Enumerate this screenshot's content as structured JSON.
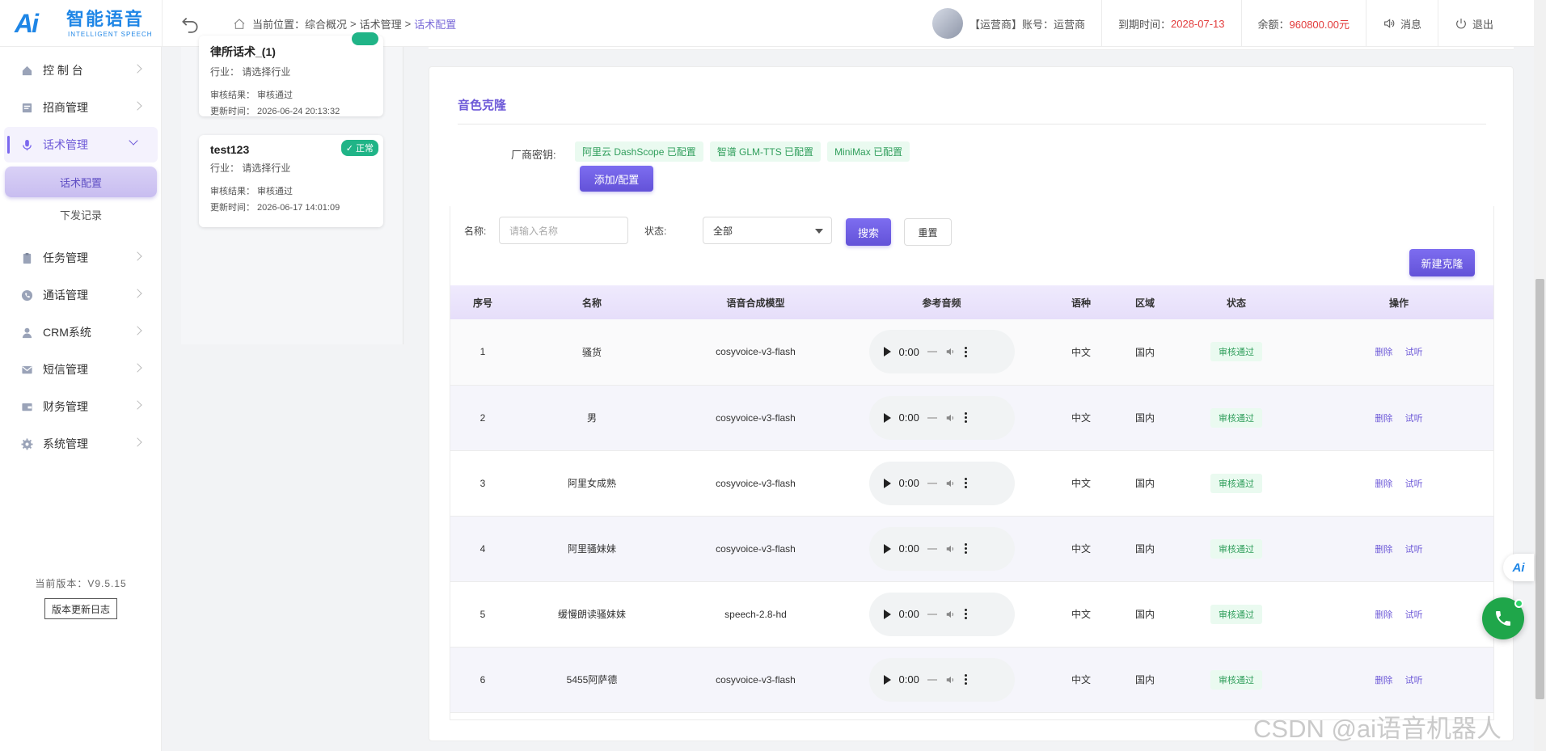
{
  "header": {
    "logo_ai": "Ai",
    "logo_cn": "智能语音",
    "logo_en": "INTELLIGENT SPEECH",
    "breadcrumb_prefix": "当前位置：",
    "breadcrumb": [
      "综合概况",
      "话术管理",
      "话术配置"
    ],
    "breadcrumb_sep": ">",
    "account": "【运营商】账号：运营商",
    "expire_label": "到期时间：",
    "expire_value": "2028-07-13",
    "balance_label": "余额：",
    "balance_value": "960800.00元",
    "message": "消息",
    "logout": "退出"
  },
  "sidebar": {
    "items": [
      {
        "label": "控 制 台",
        "icon": "home-icon"
      },
      {
        "label": "招商管理",
        "icon": "briefcase-icon"
      },
      {
        "label": "话术管理",
        "icon": "mic-icon"
      },
      {
        "label": "任务管理",
        "icon": "clipboard-icon"
      },
      {
        "label": "通话管理",
        "icon": "phone-circle-icon"
      },
      {
        "label": "CRM系统",
        "icon": "user-icon"
      },
      {
        "label": "短信管理",
        "icon": "mail-icon"
      },
      {
        "label": "财务管理",
        "icon": "wallet-icon"
      },
      {
        "label": "系统管理",
        "icon": "gear-icon"
      }
    ],
    "sub_items": [
      "话术配置",
      "下发记录"
    ],
    "version": "当前版本：V9.5.15",
    "version_log": "版本更新日志"
  },
  "cards": [
    {
      "title": "律所话术_(1)",
      "industry": "行业：   请选择行业",
      "audit": "审核结果：  审核通过",
      "updated": "更新时间：  2026-06-24 20:13:32"
    },
    {
      "title": "test123",
      "industry": "行业：   请选择行业",
      "audit": "审核结果：  审核通过",
      "updated": "更新时间：  2026-06-17 14:01:09",
      "badge": "✓ 正常"
    }
  ],
  "clone": {
    "title": "音色克隆",
    "vendor_label": "厂商密钥:",
    "vendor_tags": [
      "阿里云 DashScope 已配置",
      "智谱 GLM-TTS 已配置",
      "MiniMax 已配置"
    ],
    "add_button": "添加/配置"
  },
  "search": {
    "name_label": "名称:",
    "name_placeholder": "请输入名称",
    "status_label": "状态:",
    "status_value": "全部",
    "search_button": "搜索",
    "reset_button": "重置",
    "new_button": "新建克隆"
  },
  "table": {
    "columns": [
      "序号",
      "名称",
      "语音合成模型",
      "参考音频",
      "语种",
      "区域",
      "状态",
      "操作"
    ],
    "audio_time": "0:00",
    "delete_label": "删除",
    "listen_label": "试听",
    "rows": [
      {
        "no": "1",
        "name": "骚货",
        "model": "cosyvoice-v3-flash",
        "lang": "中文",
        "region": "国内",
        "status": "审核通过"
      },
      {
        "no": "2",
        "name": "男",
        "model": "cosyvoice-v3-flash",
        "lang": "中文",
        "region": "国内",
        "status": "审核通过"
      },
      {
        "no": "3",
        "name": "阿里女成熟",
        "model": "cosyvoice-v3-flash",
        "lang": "中文",
        "region": "国内",
        "status": "审核通过"
      },
      {
        "no": "4",
        "name": "阿里骚妹妹",
        "model": "cosyvoice-v3-flash",
        "lang": "中文",
        "region": "国内",
        "status": "审核通过"
      },
      {
        "no": "5",
        "name": "缓慢朗读骚妹妹",
        "model": "speech-2.8-hd",
        "lang": "中文",
        "region": "国内",
        "status": "审核通过"
      },
      {
        "no": "6",
        "name": "5455阿萨德",
        "model": "cosyvoice-v3-flash",
        "lang": "中文",
        "region": "国内",
        "status": "审核通过"
      }
    ]
  },
  "float_ai": "Ai",
  "watermark": "CSDN @ai语音机器人"
}
